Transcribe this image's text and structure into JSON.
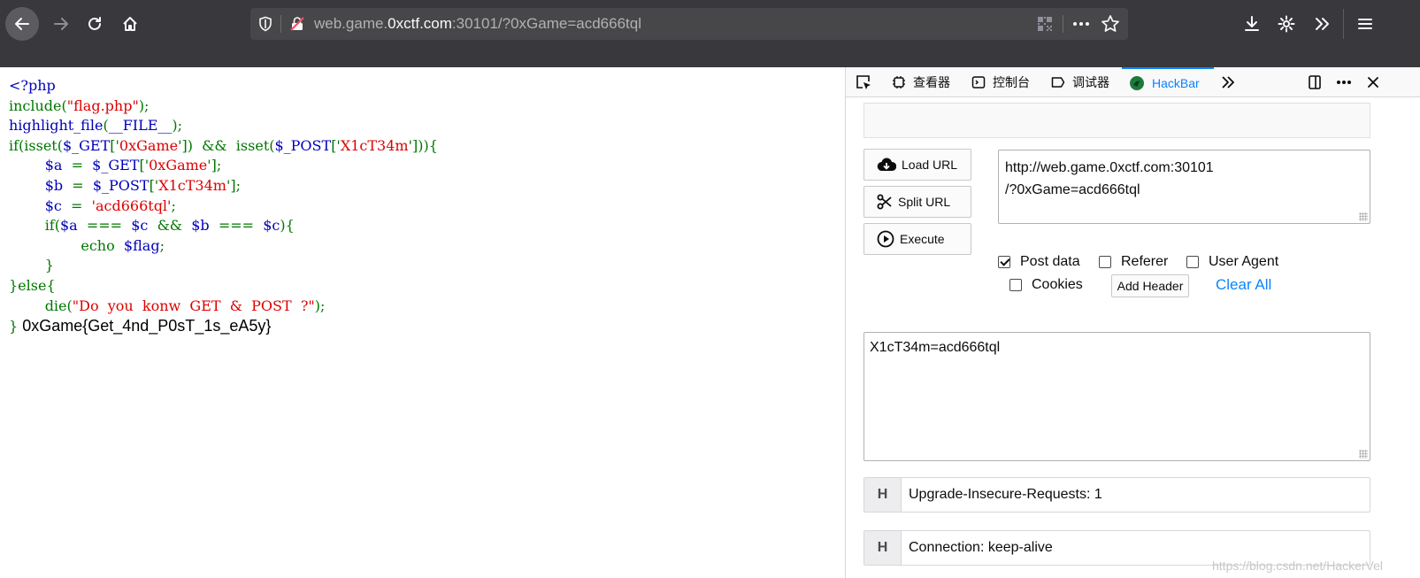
{
  "browser": {
    "url_prefix": "web.game.",
    "url_host": "0xctf.com",
    "url_suffix": ":30101/?0xGame=acd666tql"
  },
  "page": {
    "code_lines": [
      [
        {
          "t": "<?php",
          "c": "default"
        }
      ],
      [
        {
          "t": "include(",
          "c": "keyword"
        },
        {
          "t": "\"flag.php\"",
          "c": "string"
        },
        {
          "t": ");",
          "c": "keyword"
        }
      ],
      [
        {
          "t": "highlight_file",
          "c": "default"
        },
        {
          "t": "(",
          "c": "keyword"
        },
        {
          "t": "__FILE__",
          "c": "default"
        },
        {
          "t": ");",
          "c": "keyword"
        }
      ],
      [
        {
          "t": "if(isset(",
          "c": "keyword"
        },
        {
          "t": "$_GET",
          "c": "default"
        },
        {
          "t": "['",
          "c": "keyword"
        },
        {
          "t": "0xGame",
          "c": "string"
        },
        {
          "t": "'])  &&  isset(",
          "c": "keyword"
        },
        {
          "t": "$_POST",
          "c": "default"
        },
        {
          "t": "['",
          "c": "keyword"
        },
        {
          "t": "X1cT34m",
          "c": "string"
        },
        {
          "t": "'])){",
          "c": "keyword"
        }
      ],
      [
        {
          "t": "        ",
          "c": "keyword"
        },
        {
          "t": "$a",
          "c": "default"
        },
        {
          "t": "  =  ",
          "c": "keyword"
        },
        {
          "t": "$_GET",
          "c": "default"
        },
        {
          "t": "['",
          "c": "keyword"
        },
        {
          "t": "0xGame",
          "c": "string"
        },
        {
          "t": "'];",
          "c": "keyword"
        }
      ],
      [
        {
          "t": "        ",
          "c": "keyword"
        },
        {
          "t": "$b",
          "c": "default"
        },
        {
          "t": "  =  ",
          "c": "keyword"
        },
        {
          "t": "$_POST",
          "c": "default"
        },
        {
          "t": "['",
          "c": "keyword"
        },
        {
          "t": "X1cT34m",
          "c": "string"
        },
        {
          "t": "'];",
          "c": "keyword"
        }
      ],
      [
        {
          "t": "        ",
          "c": "keyword"
        },
        {
          "t": "$c",
          "c": "default"
        },
        {
          "t": "  =  ",
          "c": "keyword"
        },
        {
          "t": "'acd666tql'",
          "c": "string"
        },
        {
          "t": ";",
          "c": "keyword"
        }
      ],
      [
        {
          "t": "        if(",
          "c": "keyword"
        },
        {
          "t": "$a",
          "c": "default"
        },
        {
          "t": "  ===  ",
          "c": "keyword"
        },
        {
          "t": "$c",
          "c": "default"
        },
        {
          "t": "  &&  ",
          "c": "keyword"
        },
        {
          "t": "$b",
          "c": "default"
        },
        {
          "t": "  ===  ",
          "c": "keyword"
        },
        {
          "t": "$c",
          "c": "default"
        },
        {
          "t": "){",
          "c": "keyword"
        }
      ],
      [
        {
          "t": "                echo  ",
          "c": "keyword"
        },
        {
          "t": "$flag",
          "c": "default"
        },
        {
          "t": ";",
          "c": "keyword"
        }
      ],
      [
        {
          "t": "        }",
          "c": "keyword"
        }
      ],
      [
        {
          "t": "}else{",
          "c": "keyword"
        }
      ],
      [
        {
          "t": "        die(",
          "c": "keyword"
        },
        {
          "t": "\"Do  you  konw  GET  &  POST  ?\"",
          "c": "string"
        },
        {
          "t": ");",
          "c": "keyword"
        }
      ],
      [
        {
          "t": "}",
          "c": "keyword"
        }
      ]
    ],
    "flag_output": " 0xGame{Get_4nd_P0sT_1s_eA5y}"
  },
  "devtools": {
    "tabs": {
      "inspector": "查看器",
      "console": "控制台",
      "debugger": "调试器",
      "hackbar": "HackBar"
    },
    "hackbar": {
      "load_url": "Load URL",
      "split_url": "Split URL",
      "execute": "Execute",
      "url_line1": "http://web.game.0xctf.com:30101",
      "url_line2": "/?0xGame=acd666tql",
      "post_data_label": "Post data",
      "referer_label": "Referer",
      "user_agent_label": "User Agent",
      "cookies_label": "Cookies",
      "add_header": "Add Header",
      "clear_all": "Clear All",
      "post_body": "X1cT34m=acd666tql",
      "header_badge": "H",
      "headers": [
        "Upgrade-Insecure-Requests: 1",
        "Connection: keep-alive"
      ]
    },
    "watermark": "https://blog.csdn.net/HackerVel"
  },
  "colors": {
    "php_default": "#0000bb",
    "php_keyword": "#007700",
    "php_string": "#dd0000",
    "accent": "#0a84ff"
  }
}
